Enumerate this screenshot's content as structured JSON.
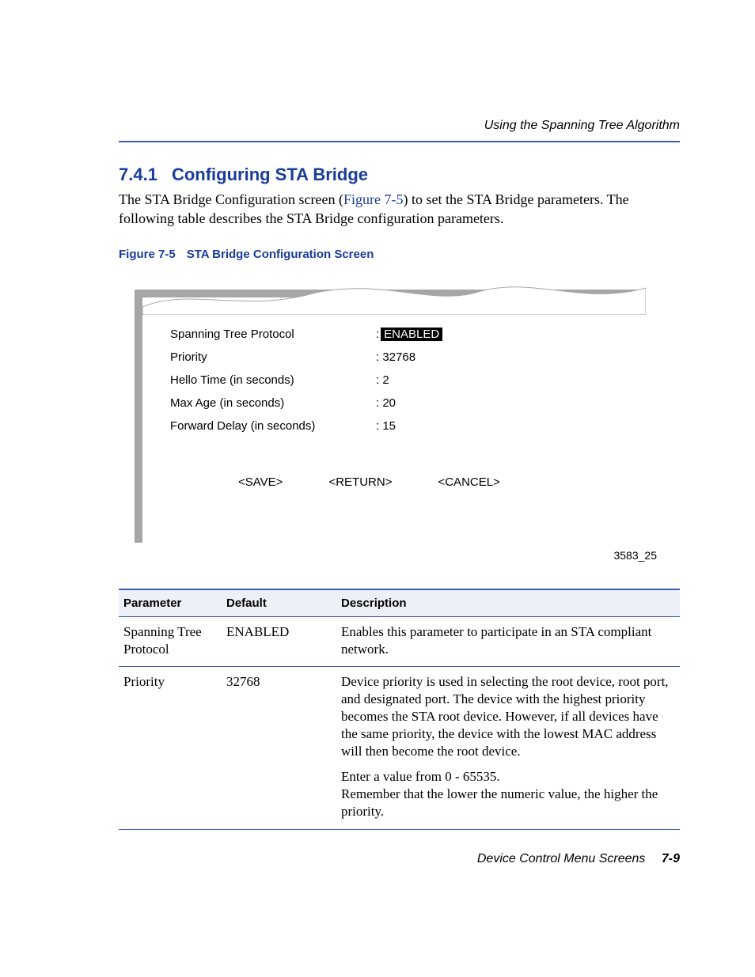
{
  "header": {
    "running_title": "Using the Spanning Tree Algorithm"
  },
  "section": {
    "number": "7.4.1",
    "title": "Configuring STA Bridge",
    "intro_pre": "The STA Bridge Configuration screen (",
    "intro_link": "Figure 7-5",
    "intro_post": ") to set the STA Bridge parameters. The following table describes the STA Bridge configuration parameters."
  },
  "figure": {
    "label_prefix": "Figure 7-5",
    "label_title": "STA Bridge Configuration Screen",
    "rows": [
      {
        "label": "Spanning Tree Protocol",
        "value": "ENABLED",
        "highlight": true
      },
      {
        "label": "Priority",
        "value": "32768",
        "highlight": false
      },
      {
        "label": "Hello Time (in seconds)",
        "value": "2",
        "highlight": false
      },
      {
        "label": "Max Age (in seconds)",
        "value": "20",
        "highlight": false
      },
      {
        "label": "Forward Delay (in seconds)",
        "value": "15",
        "highlight": false
      }
    ],
    "buttons": [
      "<SAVE>",
      "<RETURN>",
      "<CANCEL>"
    ],
    "code": "3583_25"
  },
  "table": {
    "headers": [
      "Parameter",
      "Default",
      "Description"
    ],
    "rows": [
      {
        "param": "Spanning Tree Protocol",
        "default": "ENABLED",
        "desc": "Enables this parameter to participate in an STA compliant network."
      },
      {
        "param": "Priority",
        "default": "32768",
        "desc": "Device priority is used in selecting the root device, root port, and designated port. The device with the highest priority becomes the STA root device. However, if all devices have the same priority, the device with the lowest MAC address will then become the root device.",
        "desc2": "Enter a value from 0 - 65535.\nRemember that the lower the numeric value, the higher the priority."
      }
    ]
  },
  "footer": {
    "text": "Device Control Menu Screens",
    "page": "7-9"
  }
}
